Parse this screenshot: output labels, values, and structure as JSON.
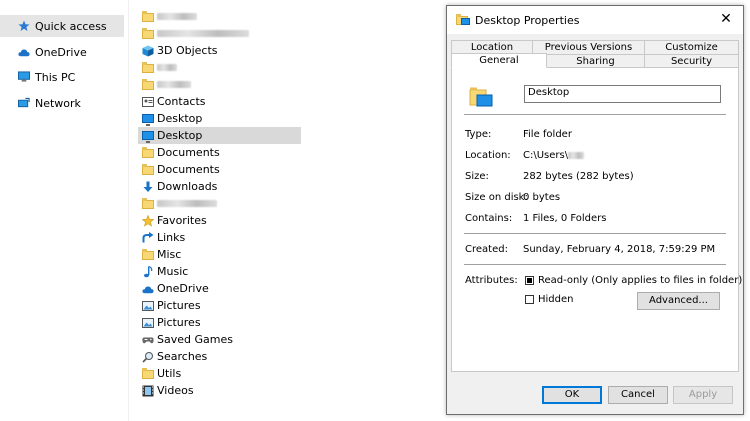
{
  "nav": {
    "items": [
      {
        "label": "Quick access",
        "icon": "star-icon",
        "selected": true
      },
      {
        "label": "OneDrive",
        "icon": "cloud-icon"
      },
      {
        "label": "This PC",
        "icon": "computer-icon"
      },
      {
        "label": "Network",
        "icon": "network-icon"
      }
    ]
  },
  "files": [
    {
      "label": "",
      "icon": "folder-icon",
      "blurred": true
    },
    {
      "label": "",
      "icon": "folder-icon",
      "blurred": true
    },
    {
      "label": "3D Objects",
      "icon": "3d-objects-icon"
    },
    {
      "label": "",
      "icon": "folder-icon",
      "blurred": true
    },
    {
      "label": "",
      "icon": "folder-icon",
      "blurred": true
    },
    {
      "label": "Contacts",
      "icon": "contacts-icon"
    },
    {
      "label": "Desktop",
      "icon": "desktop-icon"
    },
    {
      "label": "Desktop",
      "icon": "desktop-icon",
      "selected": true
    },
    {
      "label": "Documents",
      "icon": "folder-icon"
    },
    {
      "label": "Documents",
      "icon": "folder-icon"
    },
    {
      "label": "Downloads",
      "icon": "downloads-icon"
    },
    {
      "label": "",
      "icon": "folder-icon",
      "blurred": true
    },
    {
      "label": "Favorites",
      "icon": "favorites-icon"
    },
    {
      "label": "Links",
      "icon": "links-icon"
    },
    {
      "label": "Misc",
      "icon": "folder-icon"
    },
    {
      "label": "Music",
      "icon": "music-icon"
    },
    {
      "label": "OneDrive",
      "icon": "cloud-icon"
    },
    {
      "label": "Pictures",
      "icon": "pictures-icon"
    },
    {
      "label": "Pictures",
      "icon": "pictures-icon"
    },
    {
      "label": "Saved Games",
      "icon": "saved-games-icon"
    },
    {
      "label": "Searches",
      "icon": "searches-icon"
    },
    {
      "label": "Utils",
      "icon": "folder-icon"
    },
    {
      "label": "Videos",
      "icon": "videos-icon"
    }
  ],
  "dialog": {
    "title": "Desktop Properties",
    "close": "✕",
    "tabs_top": [
      "Location",
      "Previous Versions",
      "Customize"
    ],
    "tabs_bottom": [
      "General",
      "Sharing",
      "Security"
    ],
    "active_tab": "General",
    "name": "Desktop",
    "props": {
      "type_label": "Type:",
      "type_value": "File folder",
      "location_label": "Location:",
      "location_value": "C:\\Users\\",
      "size_label": "Size:",
      "size_value": "282 bytes (282 bytes)",
      "size_disk_label": "Size on disk:",
      "size_disk_value": "0 bytes",
      "contains_label": "Contains:",
      "contains_value": "1 Files, 0 Folders",
      "created_label": "Created:",
      "created_value": "Sunday, February 4, 2018, 7:59:29 PM",
      "attributes_label": "Attributes:",
      "readonly_label": "Read-only (Only applies to files in folder)",
      "readonly_checked": true,
      "hidden_label": "Hidden",
      "hidden_checked": false,
      "advanced_label": "Advanced..."
    },
    "buttons": {
      "ok": "OK",
      "cancel": "Cancel",
      "apply": "Apply"
    }
  },
  "colors": {
    "selection": "#d9d9d9",
    "accent": "#0078d7",
    "folder": "#f8d775"
  }
}
